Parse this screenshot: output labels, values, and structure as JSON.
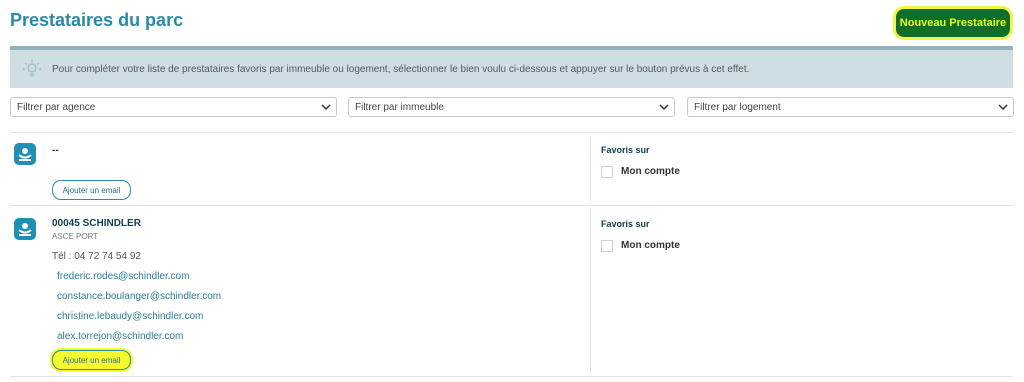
{
  "header": {
    "title": "Prestataires du parc",
    "new_button": "Nouveau Prestataire"
  },
  "info": {
    "icon": "lightbulb-icon",
    "text": "Pour compléter votre liste de prestataires favoris par immeuble ou logement, sélectionner le bien voulu ci-dessous et appuyer sur le bouton prévus à cet effet."
  },
  "filters": [
    {
      "value": "Filtrer par agence"
    },
    {
      "value": "Filtrer par immeuble"
    },
    {
      "value": "Filtrer par logement"
    }
  ],
  "providers": [
    {
      "name": "--",
      "add_email": "Ajouter un email",
      "favorites_label": "Favoris sur",
      "favorites_option": "Mon compte"
    },
    {
      "name": "00045 SCHINDLER",
      "subtitle": "ASCE PORT",
      "tel": "Tél : 04 72 74 54 92",
      "emails": [
        "frederic.rodes@schindler.com",
        "constance.boulanger@schindler.com",
        "christine.lebaudy@schindler.com",
        "alex.torrejon@schindler.com"
      ],
      "add_email": "Ajouter un email",
      "favorites_label": "Favoris sur",
      "favorites_option": "Mon compte"
    }
  ],
  "colors": {
    "title": "#2a8aa8",
    "button_bg": "#0e6e2a",
    "highlight": "#f6fb2e",
    "info_bg": "#cfdfe1"
  }
}
